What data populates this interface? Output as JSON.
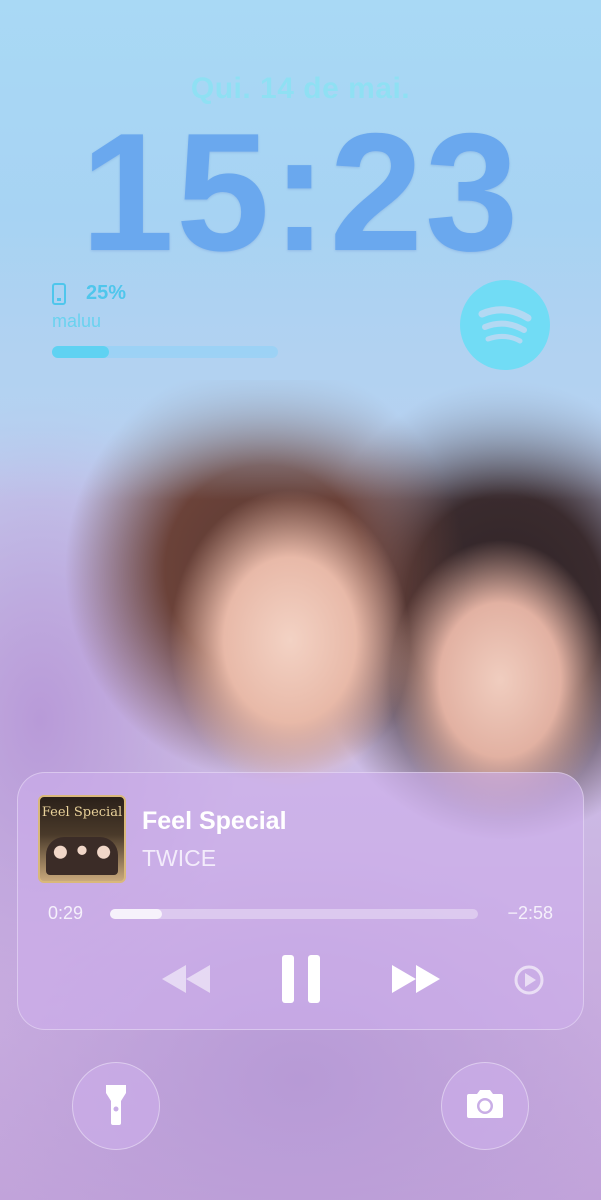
{
  "lockscreen": {
    "date": "Qui. 14 de mai.",
    "time": "15:23"
  },
  "battery_widget": {
    "percent_label": "25%",
    "device_name": "maluu",
    "level": 0.25,
    "icon": "phone-battery-icon"
  },
  "spotify_widget": {
    "icon": "spotify-logo-icon"
  },
  "now_playing": {
    "album_art_text": "Feel Special",
    "title": "Feel Special",
    "artist": "TWICE",
    "elapsed": "0:29",
    "remaining": "−2:58",
    "progress": 0.14,
    "controls": {
      "rewind_icon": "rewind-icon",
      "pause_icon": "pause-icon",
      "forward_icon": "fast-forward-icon",
      "airplay_icon": "airplay-icon"
    }
  },
  "quick_actions": {
    "left_icon": "flashlight-icon",
    "right_icon": "camera-icon"
  },
  "colors": {
    "date_text": "#8fe0f3",
    "clock_text": "#6aa8ee",
    "widget_accent": "#4fc6ec",
    "player_bg": "#cdaeeb"
  }
}
